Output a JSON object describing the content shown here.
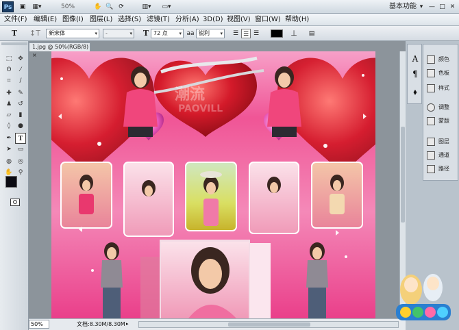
{
  "app": {
    "logo": "Ps",
    "zoom": "50%",
    "workspace": "基本功能",
    "workspace_arrow": "▾",
    "window_controls": [
      "—",
      "□",
      "✕"
    ]
  },
  "menus": [
    "文件(F)",
    "编辑(E)",
    "图像(I)",
    "图层(L)",
    "选择(S)",
    "滤镜(T)",
    "分析(A)",
    "3D(D)",
    "视图(V)",
    "窗口(W)",
    "帮助(H)"
  ],
  "options": {
    "tool_glyph": "T",
    "orient_glyph": "↕T",
    "font_family": "新宋体",
    "font_style": "-",
    "size_glyph": "T",
    "font_size": "72 点",
    "aa_glyph": "aa",
    "antialias": "锐利",
    "warp_glyph": "⊥"
  },
  "document": {
    "tab_label": "1.jpg @ 50%(RGB/8)",
    "tab_close": "×",
    "status_zoom": "50%",
    "status_doc": "文档:8.30M/8.30M",
    "watermark_text": "潮流",
    "watermark_sub": "PAOVILL"
  },
  "panels": {
    "left_column": [
      "A",
      "¶",
      "⬧"
    ],
    "items": [
      {
        "icon": "palette-icon",
        "label": "颜色"
      },
      {
        "icon": "swatches-icon",
        "label": "色板"
      },
      {
        "icon": "styles-icon",
        "label": "样式"
      },
      {
        "icon": "adjust-icon",
        "label": "调整"
      },
      {
        "icon": "mask-icon",
        "label": "蒙版"
      },
      {
        "icon": "layers-icon",
        "label": "图层"
      },
      {
        "icon": "channels-icon",
        "label": "通道"
      },
      {
        "icon": "paths-icon",
        "label": "路径"
      }
    ]
  },
  "colors": {
    "accent": "#1c3e66",
    "canvas_pink": "#ef5a9a",
    "heart_red": "#d41a2a"
  }
}
